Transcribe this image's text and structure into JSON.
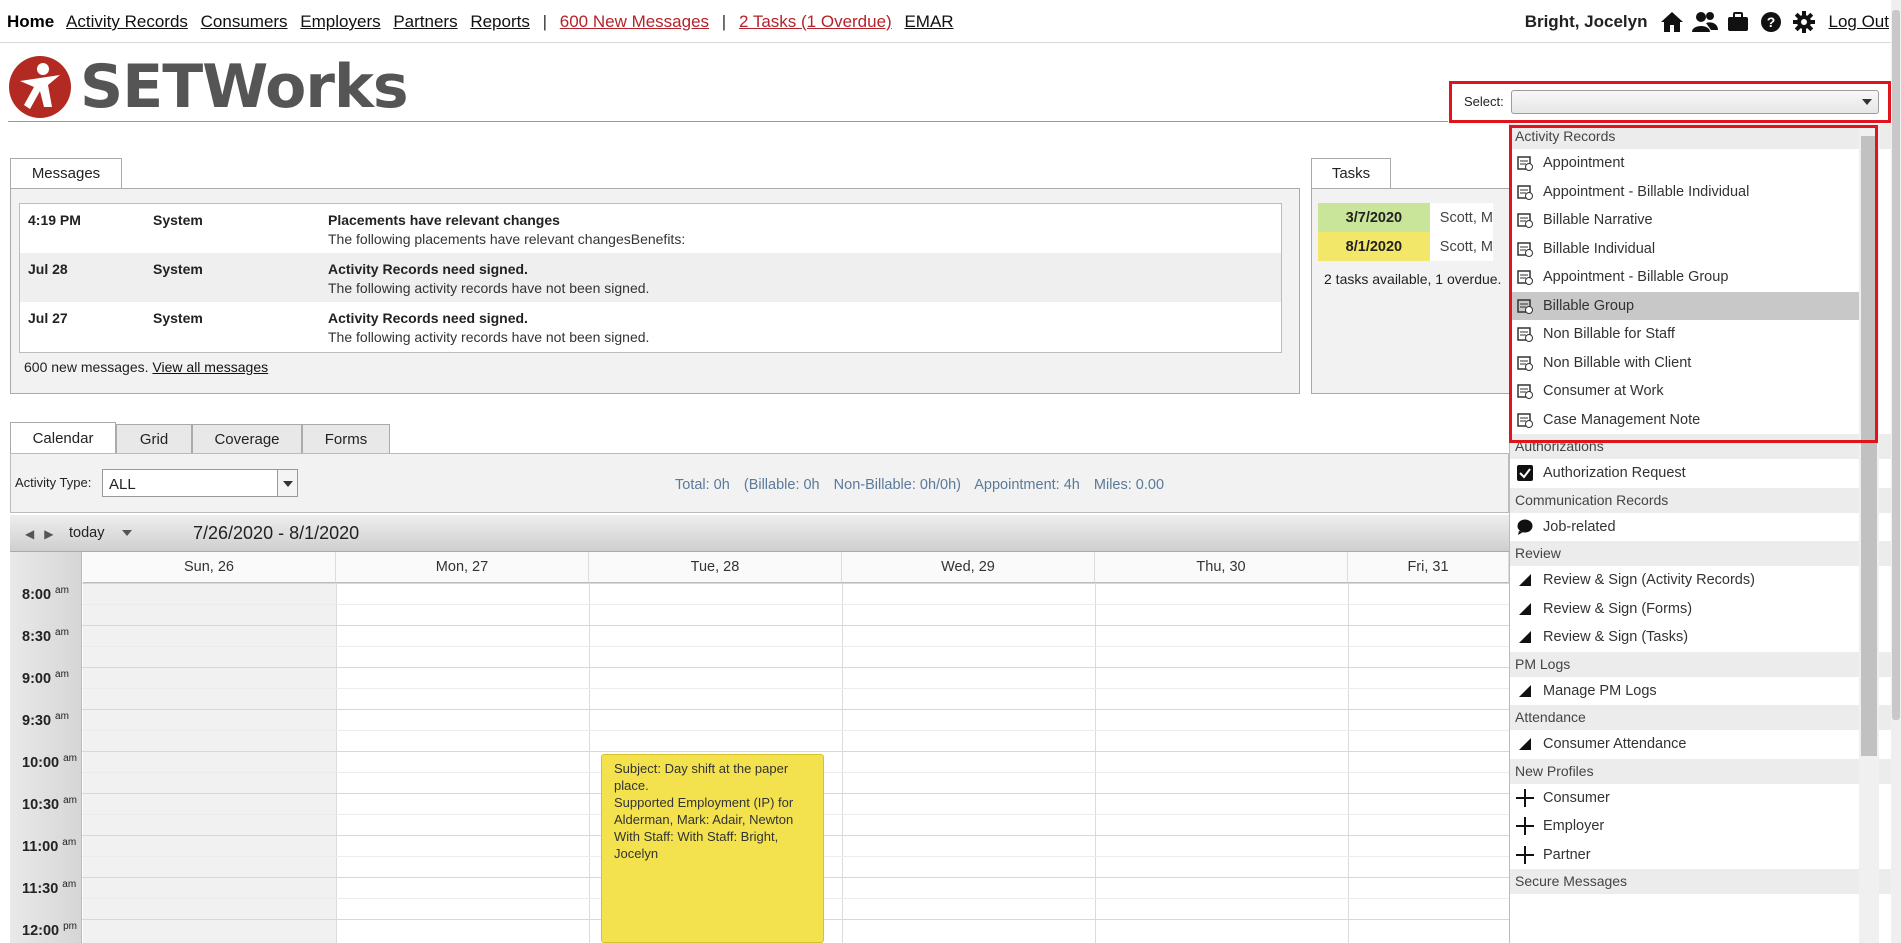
{
  "nav": {
    "home": "Home",
    "links": [
      "Activity Records",
      "Consumers",
      "Employers",
      "Partners",
      "Reports"
    ],
    "separator": "|",
    "new_messages": "600 New Messages",
    "tasks": "2 Tasks (1 Overdue)",
    "emar": "EMAR",
    "user": "Bright, Jocelyn",
    "logout": "Log Out",
    "icons": [
      "home-icon",
      "users-icon",
      "briefcase-icon",
      "help-icon",
      "gear-icon"
    ]
  },
  "brand": {
    "name": "SETWorks",
    "accent": "#b32a22"
  },
  "select": {
    "label": "Select:",
    "value": ""
  },
  "dropdown": {
    "groups": [
      {
        "label": "Activity Records",
        "items": [
          "Appointment",
          "Appointment - Billable Individual",
          "Billable Narrative",
          "Billable Individual",
          "Appointment - Billable Group",
          "Billable Group",
          "Non Billable for Staff",
          "Non Billable with Client",
          "Consumer at Work",
          "Case Management Note"
        ],
        "highlighted": "Billable Group"
      },
      {
        "label": "Authorizations",
        "items": [
          "Authorization Request"
        ]
      },
      {
        "label": "Communication Records",
        "items": [
          "Job-related"
        ]
      },
      {
        "label": "Review",
        "items": [
          "Review & Sign (Activity Records)",
          "Review & Sign (Forms)",
          "Review & Sign (Tasks)"
        ]
      },
      {
        "label": "PM Logs",
        "items": [
          "Manage PM Logs"
        ]
      },
      {
        "label": "Attendance",
        "items": [
          "Consumer Attendance"
        ]
      },
      {
        "label": "New Profiles",
        "items": [
          "Consumer",
          "Employer",
          "Partner"
        ]
      },
      {
        "label": "Secure Messages",
        "items": []
      }
    ]
  },
  "messages": {
    "tab": "Messages",
    "rows": [
      {
        "time": "4:19 PM",
        "from": "System",
        "subject": "Placements have relevant changes",
        "body": "The following placements have relevant changesBenefits:"
      },
      {
        "time": "Jul 28",
        "from": "System",
        "subject": "Activity Records need signed.",
        "body": "The following activity records have not been signed."
      },
      {
        "time": "Jul 27",
        "from": "System",
        "subject": "Activity Records need signed.",
        "body": "The following activity records have not been signed."
      }
    ],
    "footer_text": "600 new messages.",
    "footer_link": "View all messages"
  },
  "tasks": {
    "tab": "Tasks",
    "rows": [
      {
        "date": "3/7/2020",
        "name": "Scott, M",
        "color": "#c9e59a"
      },
      {
        "date": "8/1/2020",
        "name": "Scott, M",
        "color": "#f3e769"
      }
    ],
    "footer": "2 tasks available, 1 overdue."
  },
  "calendar": {
    "tabs": [
      "Calendar",
      "Grid",
      "Coverage",
      "Forms"
    ],
    "activity_type_label": "Activity Type:",
    "activity_type_value": "ALL",
    "totals": [
      "Total: 0h",
      "(Billable: 0h",
      "Non-Billable: 0h/0h)",
      "Appointment: 4h",
      "Miles: 0.00"
    ],
    "today": "today",
    "range": "7/26/2020 - 8/1/2020",
    "days": [
      "Sun, 26",
      "Mon, 27",
      "Tue, 28",
      "Wed, 29",
      "Thu, 30",
      "Fri, 31"
    ],
    "times": [
      {
        "t": "8:00",
        "ap": "am"
      },
      {
        "t": "8:30",
        "ap": "am"
      },
      {
        "t": "9:00",
        "ap": "am"
      },
      {
        "t": "9:30",
        "ap": "am"
      },
      {
        "t": "10:00",
        "ap": "am"
      },
      {
        "t": "10:30",
        "ap": "am"
      },
      {
        "t": "11:00",
        "ap": "am"
      },
      {
        "t": "11:30",
        "ap": "am"
      },
      {
        "t": "12:00",
        "ap": "pm"
      }
    ],
    "event": {
      "subject": "Subject: Day shift at the paper place.",
      "service": "Supported Employment (IP) for Alderman, Mark: Adair, Newton",
      "staff": "With Staff: With Staff: Bright, Jocelyn",
      "color": "#f3e24e"
    }
  }
}
